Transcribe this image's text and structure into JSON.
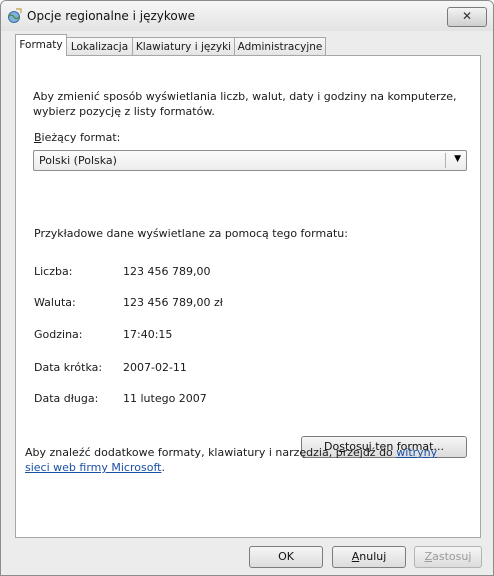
{
  "window": {
    "title": "Opcje regionalne i językowe",
    "close_label": "✕"
  },
  "tabs": [
    {
      "label": "Formaty"
    },
    {
      "label": "Lokalizacja"
    },
    {
      "label": "Klawiatury i języki"
    },
    {
      "label": "Administracyjne"
    }
  ],
  "formats": {
    "intro": "Aby zmienić sposób wyświetlania liczb, walut, daty i godziny na komputerze, wybierz pozycję z listy formatów.",
    "current_label_first": "B",
    "current_label_rest": "ieżący format:",
    "selected_format": "Polski (Polska)",
    "sample_heading": "Przykładowe dane wyświetlane za pomocą tego formatu:",
    "samples": [
      {
        "label": "Liczba:",
        "value": "123 456 789,00"
      },
      {
        "label": "Waluta:",
        "value": "123 456 789,00 zł"
      },
      {
        "label": "Godzina:",
        "value": "17:40:15"
      },
      {
        "label": "Data krótka:",
        "value": "2007-02-11"
      },
      {
        "label": "Data długa:",
        "value": "11 lutego 2007"
      }
    ],
    "customize_pre": "Do",
    "customize_key": "s",
    "customize_post": "tosuj ten format...",
    "footer_text": "Aby znaleźć dodatkowe formaty, klawiatury i narzędzia, przejdź do",
    "footer_link": "witryny sieci web firmy Microsoft",
    "footer_end": "."
  },
  "buttons": {
    "ok": "OK",
    "cancel_key": "A",
    "cancel_rest": "nuluj",
    "apply_key": "Z",
    "apply_rest": "astosuj"
  }
}
